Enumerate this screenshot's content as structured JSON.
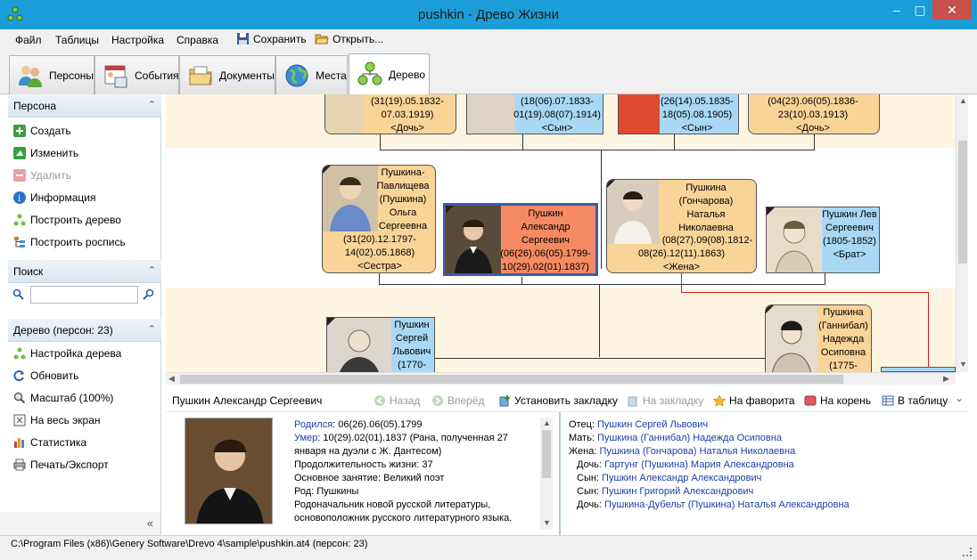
{
  "window": {
    "title": "pushkin - Древо Жизни",
    "min": "–",
    "max": "▢",
    "close": "✕"
  },
  "menu": {
    "file": "Файл",
    "tables": "Таблицы",
    "settings": "Настройка",
    "help": "Справка",
    "save": "Сохранить",
    "open": "Открыть..."
  },
  "tabs": {
    "persons": "Персоны",
    "events": "События",
    "documents": "Документы",
    "places": "Места",
    "tree": "Дерево"
  },
  "left": {
    "person_header": "Персона",
    "create": "Создать",
    "edit": "Изменить",
    "delete": "Удалить",
    "info": "Информация",
    "build_tree": "Построить дерево",
    "build_list": "Построить роспись",
    "search_header": "Поиск",
    "tree_header": "Дерево (персон: 23)",
    "tree_settings": "Настройка дерева",
    "refresh": "Обновить",
    "zoom": "Масштаб (100%)",
    "fullscreen": "На весь экран",
    "stats": "Статистика",
    "print": "Печать/Экспорт",
    "collapse": "«"
  },
  "tree": {
    "child1": {
      "line1": "(31(19).05.1832-",
      "line2": "07.03.1919)",
      "line3": "<Дочь>"
    },
    "child2": {
      "line1": "(18(06).07.1833-",
      "line2": "01(19).08(07).1914)",
      "line3": "<Сын>"
    },
    "child3": {
      "line1": "(26(14).05.1835-",
      "line2": "18(05).08.1905)",
      "line3": "<Сын>"
    },
    "child4": {
      "line1": "(04(23).06(05).1836-",
      "line2": "23(10).03.1913)",
      "line3": "<Дочь>"
    },
    "sister": {
      "l1": "Пушкина-",
      "l2": "Павлищева",
      "l3": "(Пушкина)",
      "l4": "Ольга",
      "l5": "Сергеевна",
      "l6": "(31(20).12.1797-",
      "l7": "14(02).05.1868)",
      "l8": "<Сестра>"
    },
    "main": {
      "l1": "Пушкин",
      "l2": "Александр",
      "l3": "Сергеевич",
      "l4": "(06(26).06(05).1799-",
      "l5": "10(29).02(01).1837)"
    },
    "wife": {
      "l1": "Пушкина",
      "l2": "(Гончарова)",
      "l3": "Наталья",
      "l4": "Николаевна",
      "l5": "(08(27).09(08).1812-",
      "l6": "08(26).12(11).1863)",
      "l7": "<Жена>"
    },
    "brother": {
      "l1": "Пушкин Лев",
      "l2": "Сергеевич",
      "l3": "(1805-1852)",
      "l4": "<Брат>"
    },
    "father": {
      "l1": "Пушкин",
      "l2": "Сергей",
      "l3": "Львович",
      "l4": "(1770-"
    },
    "mother": {
      "l1": "Пушкина",
      "l2": "(Ганнибал)",
      "l3": "Надежда",
      "l4": "Осиповна",
      "l5": "(1775-"
    }
  },
  "infobar": {
    "name": "Пушкин Александр Сергеевич",
    "back": "Назад",
    "forward": "Вперёд",
    "set_bookmark": "Установить закладку",
    "to_bookmark": "На закладку",
    "favorite": "На фаворита",
    "root": "На корень",
    "to_table": "В таблицу",
    "more": "⌄"
  },
  "details": {
    "born_label": "Родился",
    "born": ": 06(26).06(05).1799",
    "died_label": "Умер",
    "died": ": 10(29).02(01).1837 (Рана, полученная 27 января на дуэли с Ж. Дантесом)",
    "lifespan": "Продолжительность жизни: 37",
    "occupation": "Основное занятие: Великий поэт",
    "family": "Род: Пушкины",
    "note": "Родоначальник новой русской литературы, основоположник русского литературного языка."
  },
  "relations": [
    {
      "label": "Отец: ",
      "name": "Пушкин Сергей Львович",
      "indent": false
    },
    {
      "label": "Мать: ",
      "name": "Пушкина (Ганнибал) Надежда Осиповна",
      "indent": false
    },
    {
      "label": "Жена: ",
      "name": "Пушкина (Гончарова) Наталья Николаевна",
      "indent": false
    },
    {
      "label": "Дочь: ",
      "name": "Гартунг (Пушкина) Мария Александровна",
      "indent": true
    },
    {
      "label": "Сын: ",
      "name": "Пушкин Александр Александрович",
      "indent": true
    },
    {
      "label": "Сын: ",
      "name": "Пушкин Григорий Александрович",
      "indent": true
    },
    {
      "label": "Дочь: ",
      "name": "Пушкина-Дубельт (Пушкина) Наталья Александровна",
      "indent": true
    }
  ],
  "status": {
    "path": "C:\\Program Files (x86)\\Genery Software\\Drevo 4\\sample\\pushkin.at4 (персон: 23)"
  }
}
